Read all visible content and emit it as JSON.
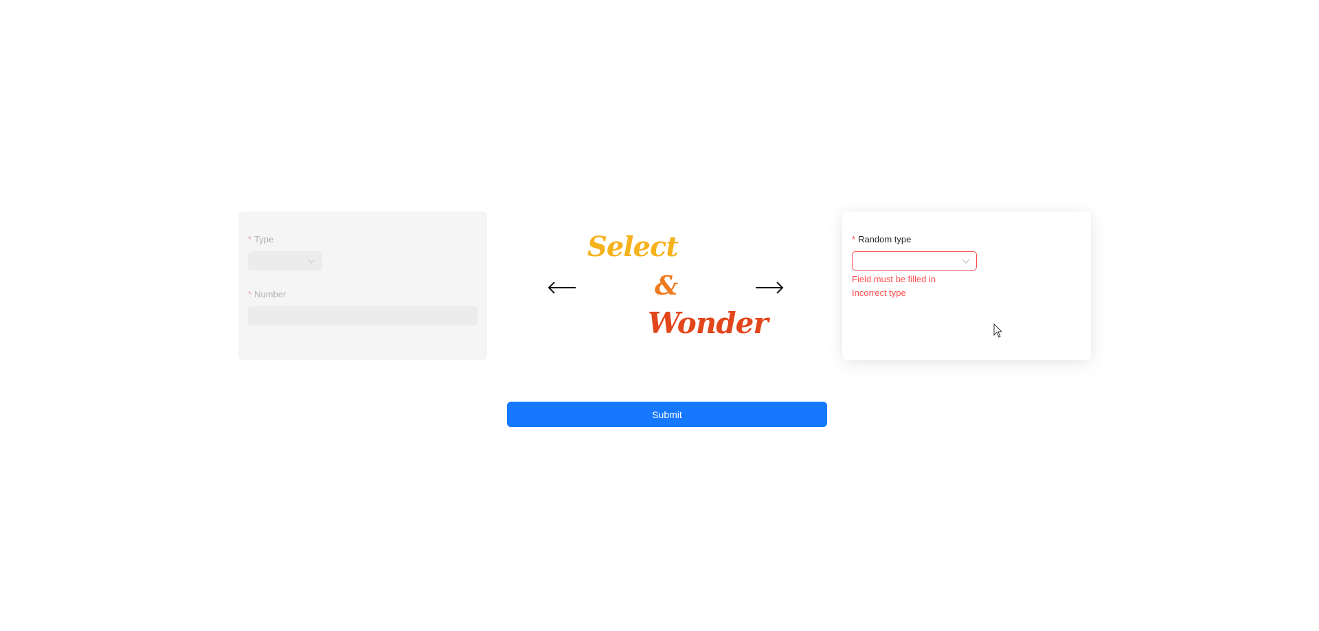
{
  "headline": {
    "word1": "Select",
    "word2": "&",
    "word3": "Wonder",
    "colors": {
      "select": "#f6b21c",
      "ampersand": "#f07a1e",
      "wonder": "#e2461b"
    }
  },
  "left_form": {
    "state": "disabled",
    "required_marker": "*",
    "type_label": "Type",
    "type_value": "",
    "number_label": "Number",
    "number_value": ""
  },
  "right_form": {
    "required_marker": "*",
    "random_type_label": "Random type",
    "random_type_value": "",
    "errors": [
      "Field must be filled in",
      "Incorrect type"
    ],
    "error_color": "#ff4d4f"
  },
  "arrows": {
    "left_icon": "arrow-left-icon",
    "right_icon": "arrow-right-icon"
  },
  "submit": {
    "label": "Submit",
    "color": "#1677ff"
  }
}
